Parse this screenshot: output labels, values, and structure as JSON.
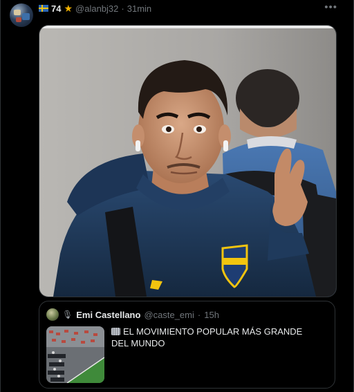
{
  "tweet": {
    "author_handle": "@alanbj32",
    "badge_number": "74",
    "separator": "·",
    "timestamp": "31min",
    "more_label": "•••"
  },
  "quote": {
    "author_name": "Emi Castellano",
    "author_handle": "@caste_emi",
    "separator": "·",
    "timestamp": "15h",
    "text": "EL MOVIMIENTO POPULAR MÁS GRANDE DEL MUNDO"
  },
  "colors": {
    "background": "#000000",
    "border": "#2f3336",
    "text_primary": "#e7e9ea",
    "text_secondary": "#71767b",
    "star": "#f5b400",
    "jacket": "#1f3a5c",
    "crest_gold": "#f2c40f"
  },
  "icons": {
    "flag": "sweden-flag-icon",
    "star": "star-icon",
    "more": "more-options-icon",
    "quote_badge": "microphone-badge-icon",
    "quote_emoji": "stadium-emoji-icon"
  }
}
